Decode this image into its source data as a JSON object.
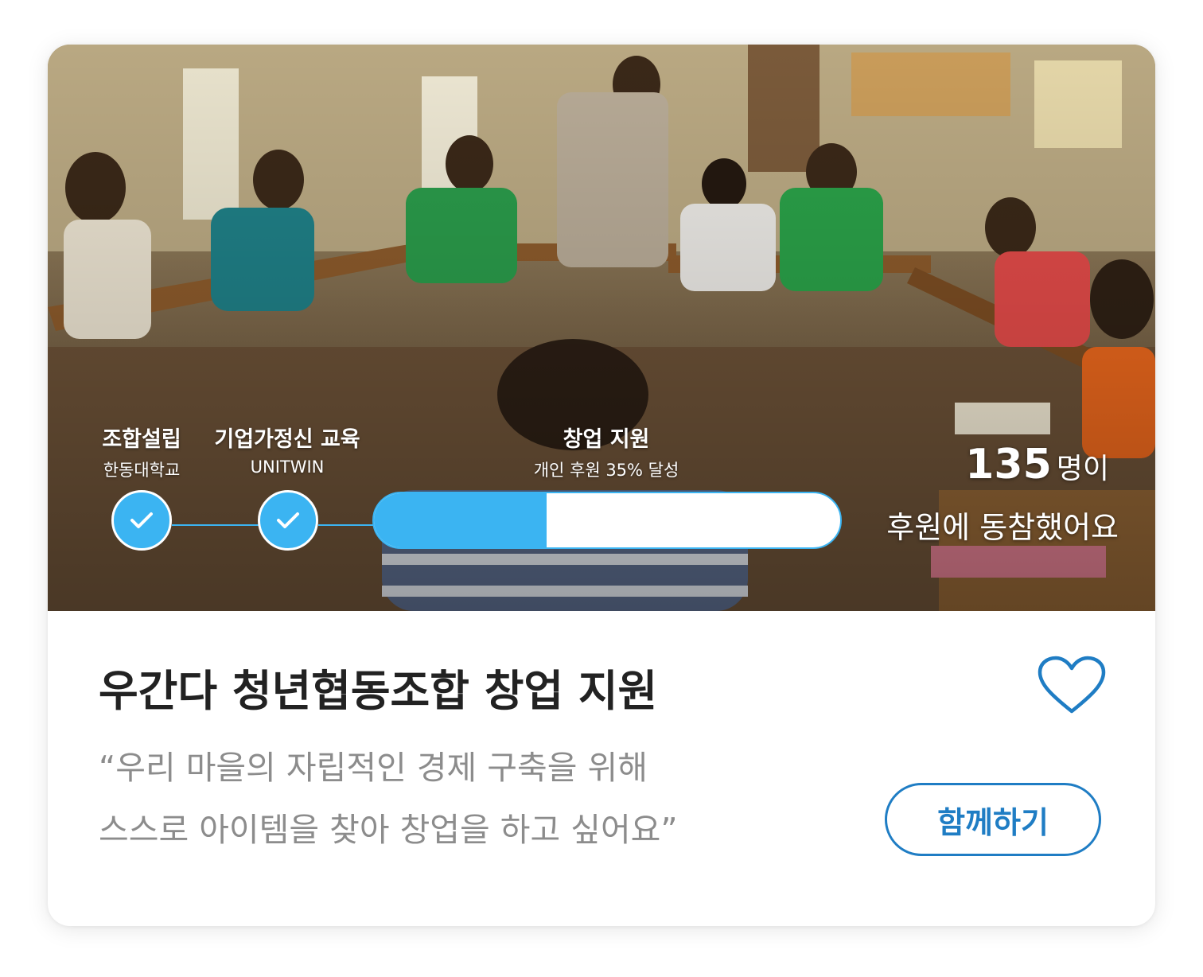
{
  "campaign": {
    "photo_icon": "classroom-photo",
    "steps": [
      {
        "title": "조합설립",
        "subtitle": "한동대학교",
        "status": "done"
      },
      {
        "title": "기업가정신 교육",
        "subtitle": "UNITWIN",
        "status": "done"
      },
      {
        "title": "창업 지원",
        "subtitle": "개인 후원 35% 달성",
        "status": "in-progress",
        "progress": 0.37
      }
    ],
    "supporters": {
      "count": "135",
      "unit": "명이",
      "caption": "후원에 동참했어요"
    },
    "title": "우간다 청년협동조합 창업 지원",
    "quote_lines": [
      "“우리 마을의 자립적인 경제 구축을 위해",
      "스스로 아이템을 찾아 창업을 하고 싶어요”"
    ],
    "join_label": "함께하기",
    "colors": {
      "accent": "#3bb4f2",
      "button": "#1f7dc4",
      "title": "#222222",
      "quote": "#8c8c8c"
    }
  }
}
